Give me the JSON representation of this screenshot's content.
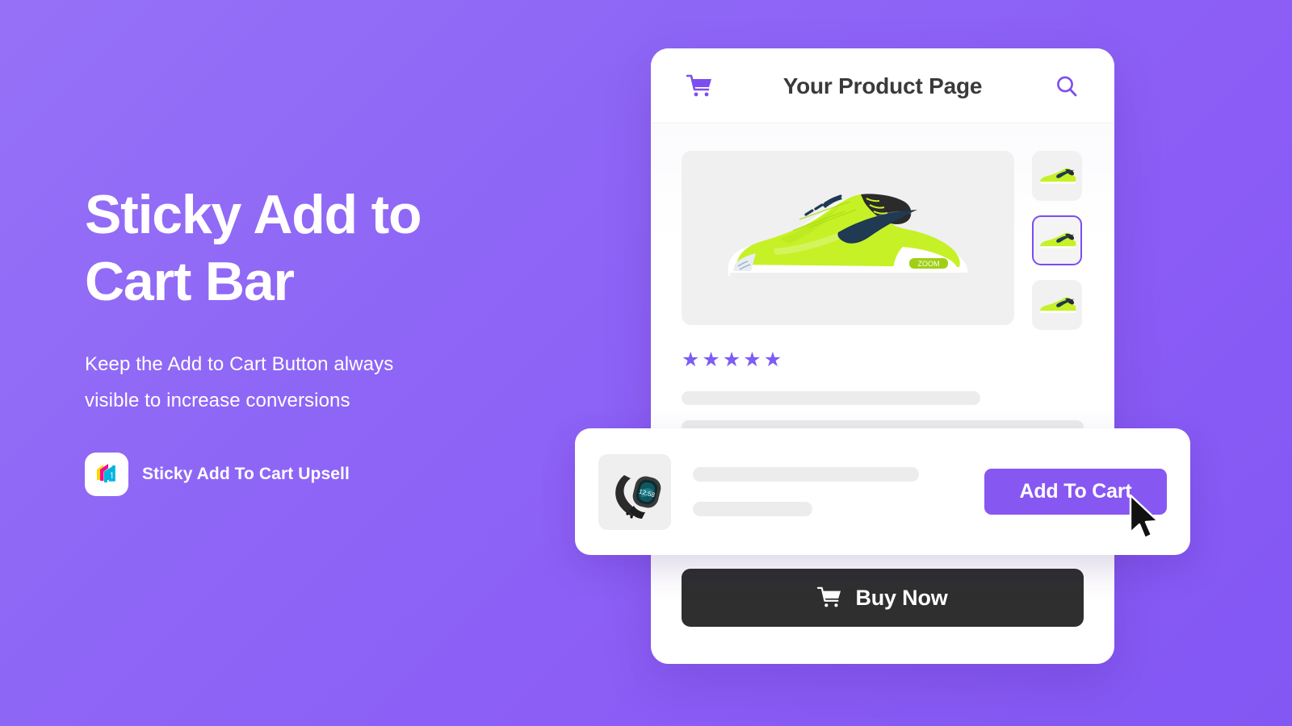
{
  "theme": {
    "bg_start": "#9671F7",
    "bg_end": "#8257F3",
    "accent_purple": "#8757F2",
    "dark_button": "#2F2F2F",
    "star_color": "#7C5CF5",
    "placeholder_gray": "#ECECEC"
  },
  "promo": {
    "title": "Sticky Add to Cart Bar",
    "subtitle": "Keep the Add to Cart Button always visible to increase conversions",
    "brand_name": "Sticky Add To Cart Upsell",
    "logo_icon": "layered-brackets-logo"
  },
  "device": {
    "header": {
      "title": "Your Product Page",
      "cart_icon": "shopping-cart-icon",
      "search_icon": "search-icon"
    },
    "gallery": {
      "hero_alt": "neon green tennis shoe",
      "thumbnails": [
        {
          "alt": "shoe thumbnail 1",
          "selected": false
        },
        {
          "alt": "shoe thumbnail 2",
          "selected": true
        },
        {
          "alt": "shoe thumbnail 3",
          "selected": false
        }
      ]
    },
    "rating": {
      "stars": 5,
      "glyph": "★"
    },
    "placeholder_lines": 3,
    "buy_now": {
      "label": "Buy Now",
      "icon": "shopping-cart-icon"
    }
  },
  "sticky_bar": {
    "thumb_alt": "black fitness tracker watch",
    "placeholder_lines": 2,
    "add_to_cart_label": "Add To Cart",
    "cursor_icon": "mouse-pointer-icon"
  }
}
